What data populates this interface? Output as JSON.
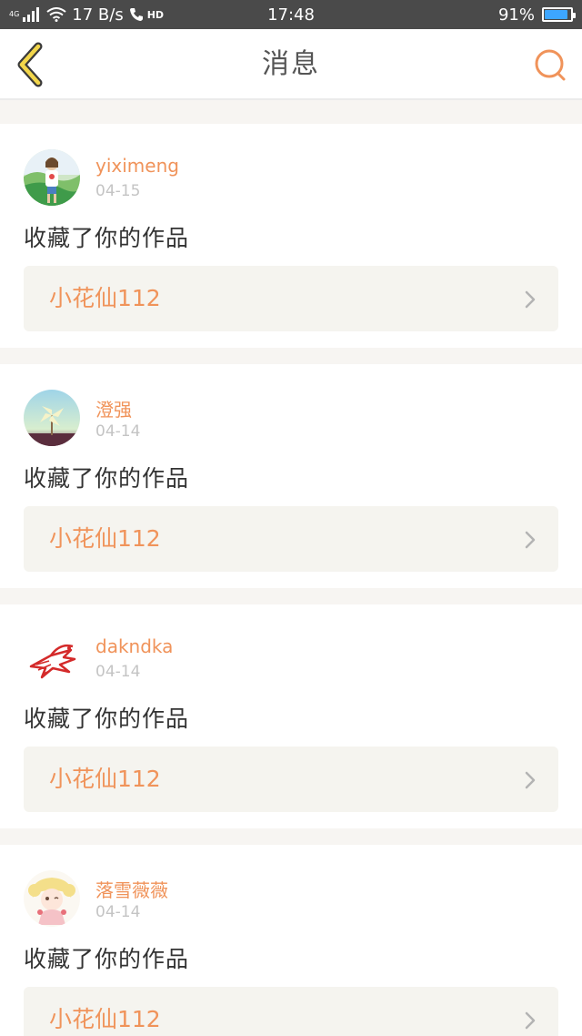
{
  "status_bar": {
    "network_label": "4G",
    "speed": "17 B/s",
    "hd_label": "HD",
    "time": "17:48",
    "battery_percent": "91%",
    "battery_level": 0.91,
    "battery_color": "#3da6ff"
  },
  "header": {
    "title": "消息",
    "back_icon": "chevron-left-icon",
    "search_icon": "search-icon",
    "accent_color": "#f0935a"
  },
  "messages": [
    {
      "username": "yiximeng",
      "date": "04-15",
      "action": "收藏了你的作品",
      "work_title": "小花仙112",
      "avatar_icon": "user-photo-avatar"
    },
    {
      "username": "澄强",
      "date": "04-14",
      "action": "收藏了你的作品",
      "work_title": "小花仙112",
      "avatar_icon": "pinwheel-avatar"
    },
    {
      "username": "dakndka",
      "date": "04-14",
      "action": "收藏了你的作品",
      "work_title": "小花仙112",
      "avatar_icon": "red-bird-avatar"
    },
    {
      "username": "落雪薇薇",
      "date": "04-14",
      "action": "收藏了你的作品",
      "work_title": "小花仙112",
      "avatar_icon": "anime-girl-avatar"
    }
  ]
}
